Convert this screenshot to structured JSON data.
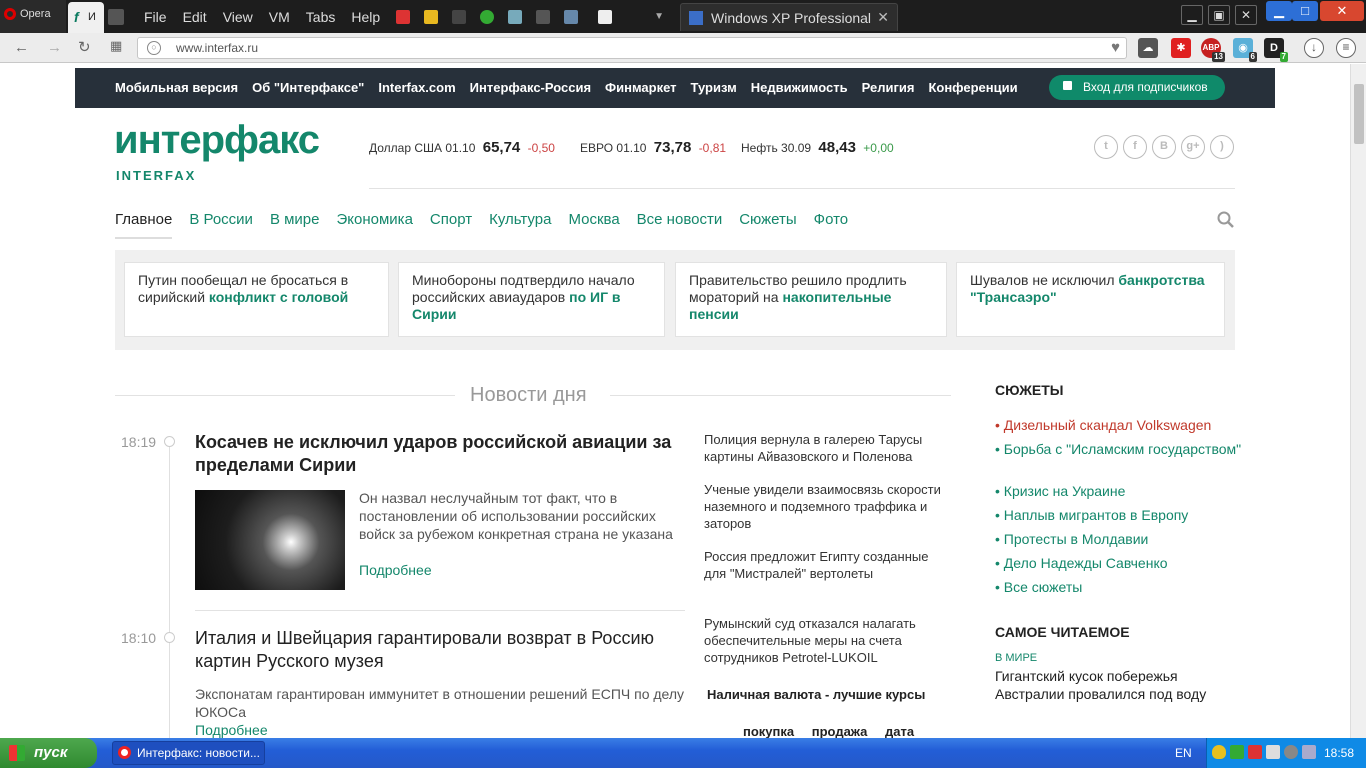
{
  "browser": {
    "opera_tab_label": "Opera",
    "page_tab_label": "И",
    "url": "www.interfax.ru"
  },
  "vm": {
    "menu": [
      "File",
      "Edit",
      "View",
      "VM",
      "Tabs",
      "Help"
    ],
    "tab_label": "Windows XP Professional",
    "tab_close": "✕"
  },
  "extensions": {
    "abp_badge": "13",
    "ghost_badge": "6",
    "d_badge": "7"
  },
  "site": {
    "top_links": [
      "Мобильная версия",
      "Об \"Интерфаксе\"",
      "Interfax.com",
      "Интерфакс-Россия",
      "Финмаркет",
      "Туризм",
      "Недвижимость",
      "Религия",
      "Конференции"
    ],
    "login_label": "Вход для подписчиков",
    "logo_word": "интерфакс",
    "logo_sub": "INTERFAX",
    "rates": [
      {
        "label": "Доллар США 01.10",
        "value": "65,74",
        "change": "-0,50"
      },
      {
        "label": "ЕВРО 01.10",
        "value": "73,78",
        "change": "-0,81"
      },
      {
        "label": "Нефть 30.09",
        "value": "48,43",
        "change": "+0,00"
      }
    ],
    "social_icons": [
      "twitter-icon",
      "facebook-icon",
      "vk-icon",
      "googleplus-icon",
      "rss-icon"
    ],
    "nav": [
      "Главное",
      "В России",
      "В мире",
      "Экономика",
      "Спорт",
      "Культура",
      "Москва",
      "Все новости",
      "Сюжеты",
      "Фото"
    ],
    "headlines": [
      {
        "plain": "Путин пообещал не бросаться в сирийский ",
        "bold": "конфликт с головой"
      },
      {
        "plain": "Минобороны подтвердило начало российских авиаударов ",
        "bold": "по ИГ в Сирии"
      },
      {
        "plain": "Правительство решило продлить мораторий на ",
        "bold": "накопительные пенсии"
      },
      {
        "plain": "Шувалов не исключил ",
        "bold": "банкротства \"Трансаэро\""
      }
    ],
    "news_day_title": "Новости дня",
    "articles": [
      {
        "time": "18:19",
        "title": "Косачев не исключил ударов российской авиации за пределами Сирии",
        "text": "Он назвал неслучайным тот факт, что в постановлении об использовании российских войск за рубежом конкретная страна не указана",
        "more": "Подробнее"
      },
      {
        "time": "18:10",
        "title": "Италия и Швейцария гарантировали возврат в Россию картин Русского музея",
        "text": "Экспонатам гарантирован иммунитет в отношении решений ЕСПЧ по делу ЮКОСа",
        "more": "Подробнее"
      }
    ],
    "side_news": [
      "Полиция вернула в галерею Тарусы картины Айвазовского и Поленова",
      "Ученые увидели взаимосвязь скорости наземного и подземного траффика и заторов",
      "Россия предложит Египту созданные для \"Мистралей\" вертолеты",
      "Румынский суд отказался налагать обеспечительные меры на счета сотрудников Petrotel-LUKOIL"
    ],
    "currency": {
      "title": "Наличная валюта - лучшие курсы",
      "headers": [
        "покупка",
        "продажа",
        "дата"
      ]
    },
    "plots_heading": "СЮЖЕТЫ",
    "plots": [
      "• Дизельный скандал Volkswagen",
      "• Борьба с \"Исламским государством\"",
      "• Кризис на Украине",
      "• Наплыв мигрантов в Европу",
      "• Протесты в Молдавии",
      "• Дело Надежды Савченко",
      "• Все сюжеты"
    ],
    "most_read_heading": "САМОЕ ЧИТАЕМОЕ",
    "most_read_category": "В МИРЕ",
    "most_read_title": "Гигантский кусок побережья Австралии провалился под воду"
  },
  "taskbar": {
    "start_label": "пуск",
    "task_label": "Интерфакс: новости...",
    "lang": "EN",
    "clock": "18:58"
  },
  "colors": {
    "brand_green": "#14876b",
    "sitebar_bg": "#27303a",
    "hot_red": "#c0392b"
  }
}
